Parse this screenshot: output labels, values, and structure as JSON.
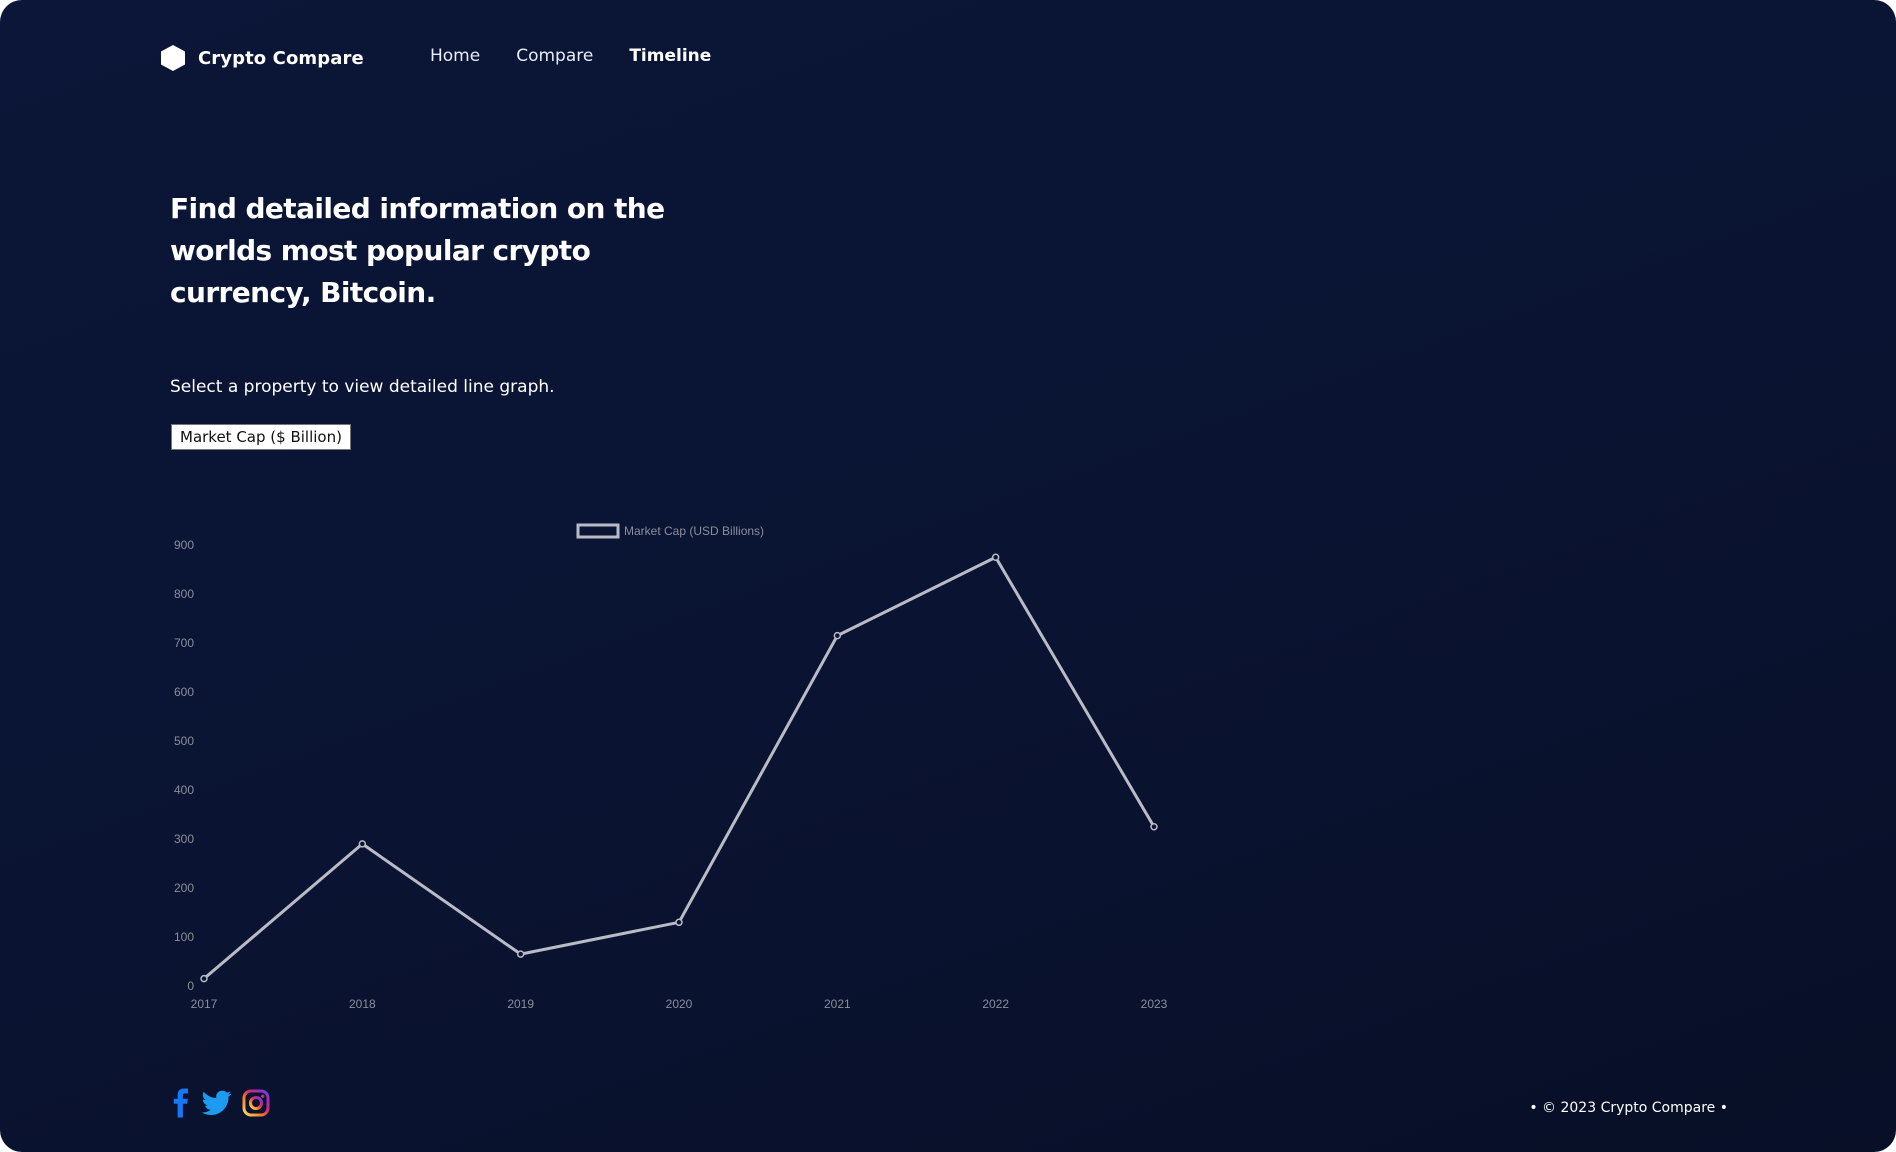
{
  "brand": {
    "name": "Crypto Compare",
    "icon": "hexagon-logo-icon"
  },
  "nav": {
    "items": [
      {
        "label": "Home",
        "active": false
      },
      {
        "label": "Compare",
        "active": false
      },
      {
        "label": "Timeline",
        "active": true
      }
    ]
  },
  "hero": {
    "title": "Find detailed information on the worlds most popular crypto currency, Bitcoin.",
    "instruction": "Select a property to view detailed line graph."
  },
  "property_select": {
    "selected": "Market Cap ($ Billion)"
  },
  "chart_data": {
    "type": "line",
    "title": "",
    "xlabel": "",
    "ylabel": "",
    "categories": [
      "2017",
      "2018",
      "2019",
      "2020",
      "2021",
      "2022",
      "2023"
    ],
    "series": [
      {
        "name": "Market Cap (USD Billions)",
        "values": [
          15,
          290,
          65,
          130,
          715,
          875,
          325
        ]
      }
    ],
    "ylim": [
      0,
      900
    ],
    "yticks": [
      0,
      100,
      200,
      300,
      400,
      500,
      600,
      700,
      800,
      900
    ],
    "legend": "top-center",
    "grid": false,
    "line_color": "#b9bcc5"
  },
  "social": [
    {
      "name": "facebook-icon",
      "color": "#1877f2"
    },
    {
      "name": "twitter-icon",
      "color": "#1d9bf0"
    },
    {
      "name": "instagram-icon",
      "color": "#dd2a7b"
    }
  ],
  "footer": {
    "copyright": "• © 2023 Crypto Compare •"
  }
}
